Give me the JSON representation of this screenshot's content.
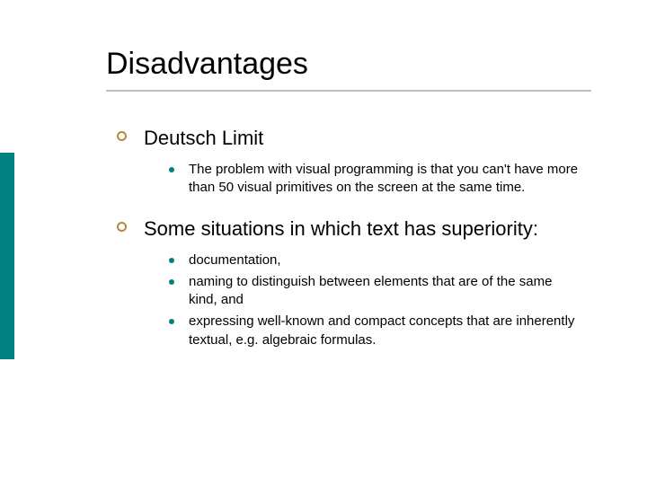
{
  "title": "Disadvantages",
  "items": [
    {
      "heading": "Deutsch Limit",
      "subs": [
        "The problem with visual programming is that you can't have more than 50 visual primitives on the screen at the same time."
      ]
    },
    {
      "heading": "Some situations in which text has superiority:",
      "subs": [
        "documentation,",
        "naming to distinguish between elements that are of the same kind, and",
        "expressing well-known and compact concepts that are inherently textual, e.g. algebraic formulas."
      ]
    }
  ]
}
